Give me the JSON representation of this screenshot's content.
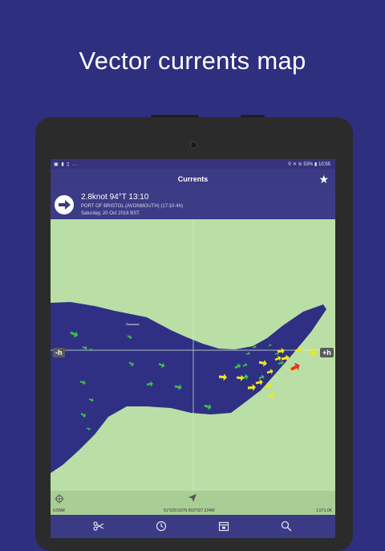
{
  "headline": "Vector currents map",
  "status_bar": {
    "time": "10:55",
    "battery": "53%"
  },
  "app_bar": {
    "title": "Currents"
  },
  "current_info": {
    "reading": "2.8knot 94°T 13:10",
    "station": "PORT OF BRISTOL (AVONMOUTH) (17:10-4h)",
    "date": "Saturday, 20 Oct 2018 BST"
  },
  "map": {
    "place_label": "Swansea",
    "time_back_label": "-h",
    "time_forward_label": "+h",
    "scale_left": "9.5NM",
    "cursor_coordinates": "51°029.537N 003°027.224W",
    "scale_right": "1:571.0K"
  },
  "colors": {
    "background": "#2e2f7f",
    "sea": "#2f3083",
    "land": "#b9dfa6",
    "arrow_green": "#3dbb4c",
    "arrow_yellow": "#f2e51b",
    "arrow_red": "#e5322b"
  },
  "nav_icons": [
    "scissors-icon",
    "clock-icon",
    "calendar-icon",
    "search-icon"
  ]
}
